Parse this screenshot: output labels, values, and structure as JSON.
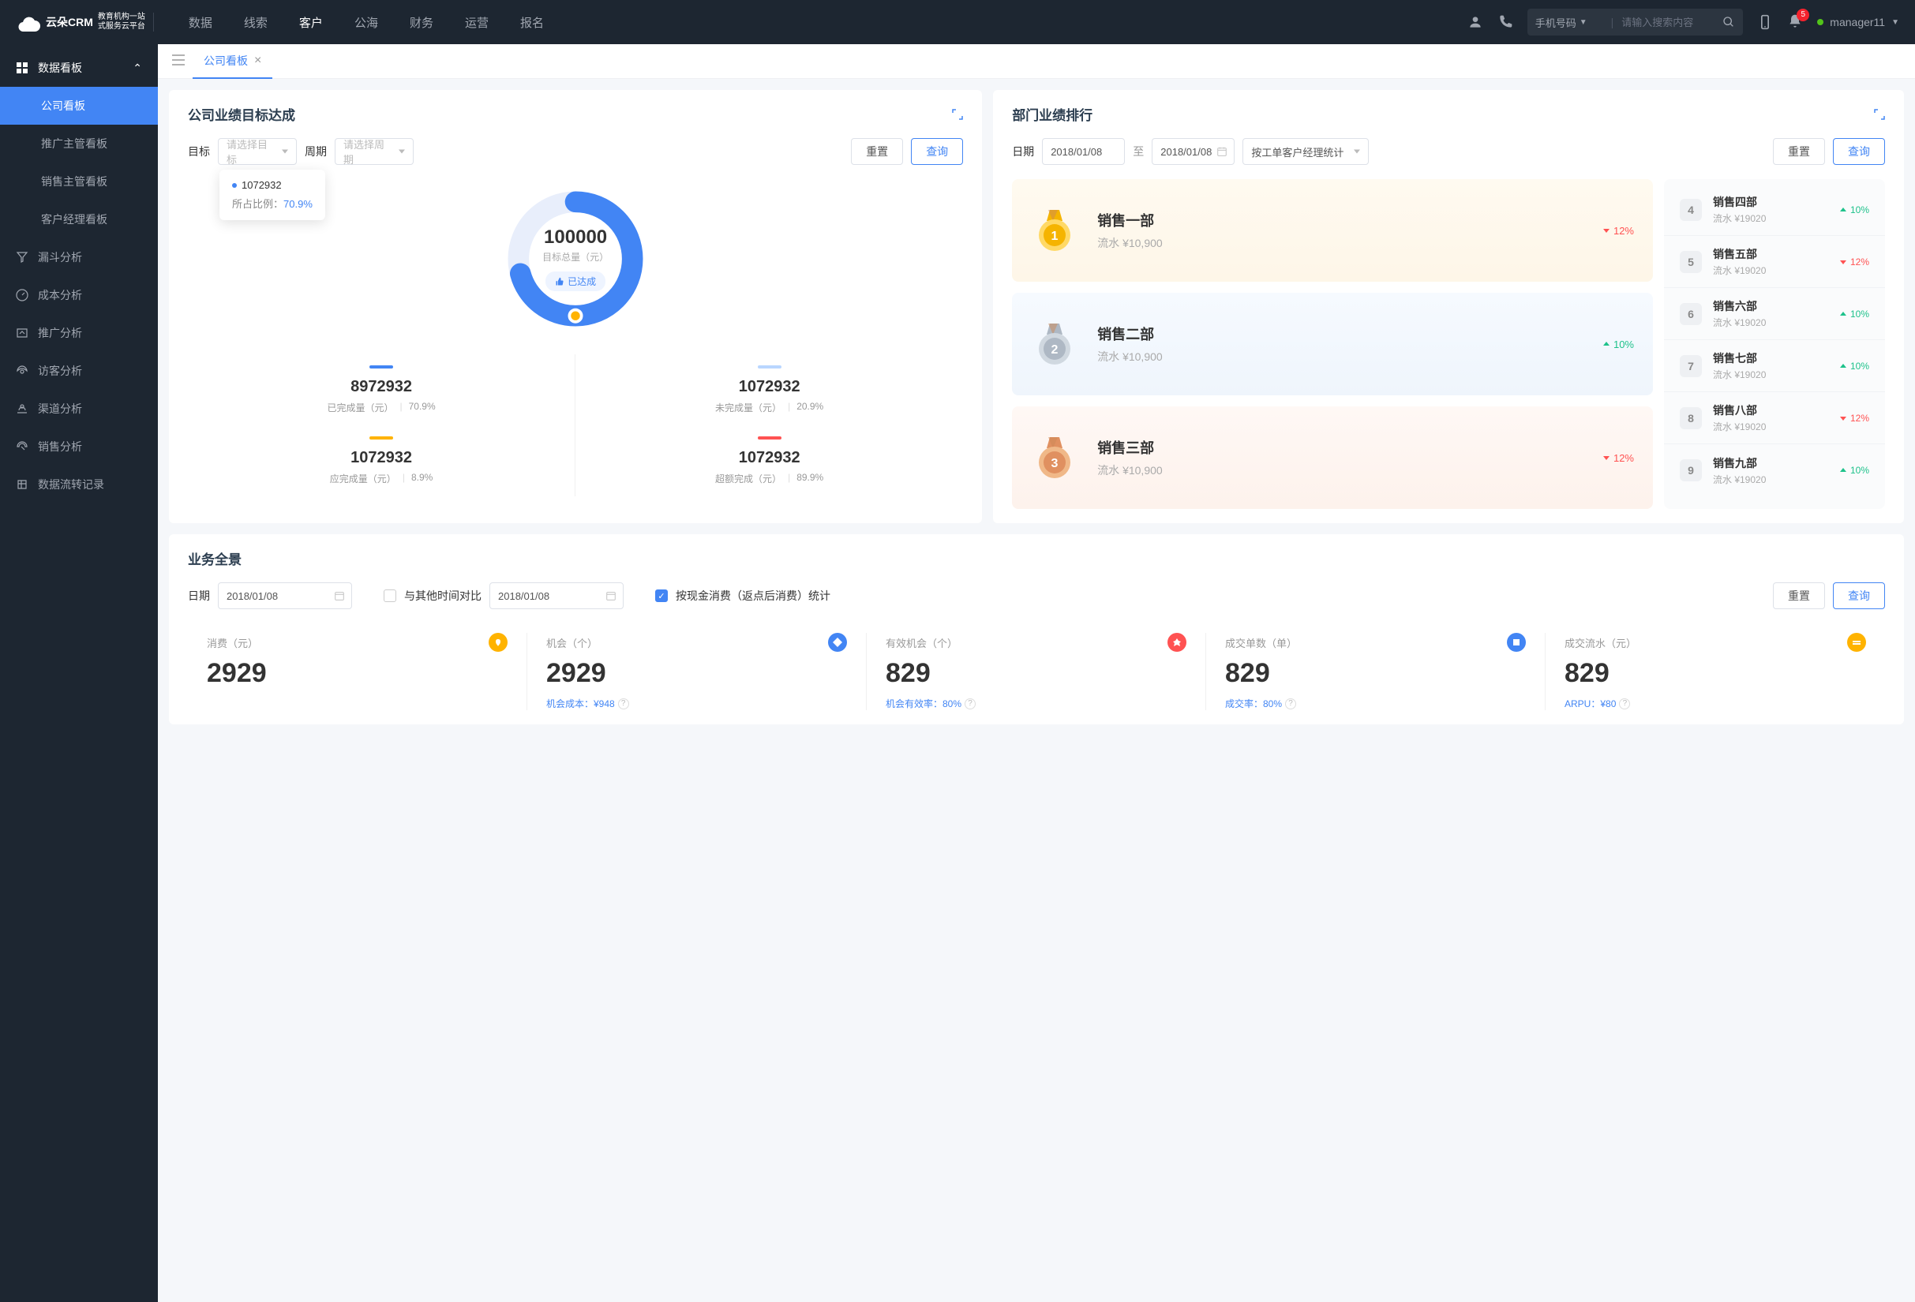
{
  "header": {
    "brand": "云朵CRM",
    "brand_sub1": "教育机构一站",
    "brand_sub2": "式服务云平台",
    "nav": [
      "数据",
      "线索",
      "客户",
      "公海",
      "财务",
      "运营",
      "报名"
    ],
    "active_nav": 2,
    "search_type": "手机号码",
    "search_placeholder": "请输入搜索内容",
    "notif_count": "5",
    "user": "manager11"
  },
  "sidebar": {
    "group": "数据看板",
    "subs": [
      "公司看板",
      "推广主管看板",
      "销售主管看板",
      "客户经理看板"
    ],
    "active_sub": 0,
    "items": [
      "漏斗分析",
      "成本分析",
      "推广分析",
      "访客分析",
      "渠道分析",
      "销售分析",
      "数据流转记录"
    ]
  },
  "tabs": {
    "active": "公司看板"
  },
  "goal_panel": {
    "title": "公司业绩目标达成",
    "target_label": "目标",
    "target_placeholder": "请选择目标",
    "period_label": "周期",
    "period_placeholder": "请选择周期",
    "reset": "重置",
    "query": "查询",
    "tooltip_value": "1072932",
    "tooltip_label": "所占比例：",
    "tooltip_pct": "70.9%",
    "total": "100000",
    "total_label": "目标总量（元）",
    "badge": "已达成",
    "metrics": [
      {
        "num": "8972932",
        "label": "已完成量（元）",
        "pct": "70.9%",
        "cls": "blue"
      },
      {
        "num": "1072932",
        "label": "未完成量（元）",
        "pct": "20.9%",
        "cls": "lightblue"
      },
      {
        "num": "1072932",
        "label": "应完成量（元）",
        "pct": "8.9%",
        "cls": "orange"
      },
      {
        "num": "1072932",
        "label": "超额完成（元）",
        "pct": "89.9%",
        "cls": "red"
      }
    ]
  },
  "rank_panel": {
    "title": "部门业绩排行",
    "date_label": "日期",
    "date_from": "2018/01/08",
    "date_sep": "至",
    "date_to": "2018/01/08",
    "group_by": "按工单客户经理统计",
    "reset": "重置",
    "query": "查询",
    "top": [
      {
        "name": "销售一部",
        "sub": "流水 ¥10,900",
        "delta": "12%",
        "dir": "down"
      },
      {
        "name": "销售二部",
        "sub": "流水 ¥10,900",
        "delta": "10%",
        "dir": "up"
      },
      {
        "name": "销售三部",
        "sub": "流水 ¥10,900",
        "delta": "12%",
        "dir": "down"
      }
    ],
    "rest": [
      {
        "n": "4",
        "name": "销售四部",
        "sub": "流水 ¥19020",
        "delta": "10%",
        "dir": "up"
      },
      {
        "n": "5",
        "name": "销售五部",
        "sub": "流水 ¥19020",
        "delta": "12%",
        "dir": "down"
      },
      {
        "n": "6",
        "name": "销售六部",
        "sub": "流水 ¥19020",
        "delta": "10%",
        "dir": "up"
      },
      {
        "n": "7",
        "name": "销售七部",
        "sub": "流水 ¥19020",
        "delta": "10%",
        "dir": "up"
      },
      {
        "n": "8",
        "name": "销售八部",
        "sub": "流水 ¥19020",
        "delta": "12%",
        "dir": "down"
      },
      {
        "n": "9",
        "name": "销售九部",
        "sub": "流水 ¥19020",
        "delta": "10%",
        "dir": "up"
      }
    ]
  },
  "overview": {
    "title": "业务全景",
    "date_label": "日期",
    "date1": "2018/01/08",
    "compare_label": "与其他时间对比",
    "date2": "2018/01/08",
    "cash_label": "按现金消费（返点后消费）统计",
    "reset": "重置",
    "query": "查询",
    "kpis": [
      {
        "label": "消费（元）",
        "val": "2929",
        "sub": "",
        "color": "#ffb300"
      },
      {
        "label": "机会（个）",
        "val": "2929",
        "sub": "机会成本：¥948",
        "color": "#4285f4"
      },
      {
        "label": "有效机会（个）",
        "val": "829",
        "sub": "机会有效率：80%",
        "color": "#ff5252"
      },
      {
        "label": "成交单数（单）",
        "val": "829",
        "sub": "成交率：80%",
        "color": "#4285f4"
      },
      {
        "label": "成交流水（元）",
        "val": "829",
        "sub": "ARPU：¥80",
        "color": "#ffb300"
      }
    ]
  },
  "chart_data": {
    "type": "pie",
    "title": "目标总量（元）",
    "total": 100000,
    "series": [
      {
        "name": "已完成量",
        "value": 8972932,
        "pct": 70.9
      },
      {
        "name": "未完成量",
        "value": 1072932,
        "pct": 20.9
      },
      {
        "name": "应完成量",
        "value": 1072932,
        "pct": 8.9
      },
      {
        "name": "超额完成",
        "value": 1072932,
        "pct": 89.9
      }
    ]
  }
}
